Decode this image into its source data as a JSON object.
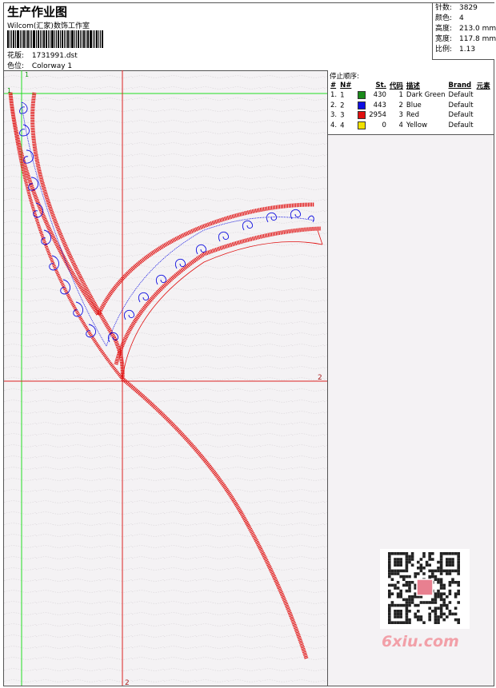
{
  "header": {
    "title": "生产作业图",
    "company": "Wilcom(汇家)数饰工作室",
    "design_label": "花版:",
    "design_value": "1731991.dst",
    "colorway_label": "色位:",
    "colorway_value": "Colorway 1"
  },
  "stats": {
    "stitches_label": "针数:",
    "stitches_value": "3829",
    "colors_label": "颜色:",
    "colors_value": "4",
    "height_label": "高度:",
    "height_value": "213.0 mm",
    "width_label": "宽度:",
    "width_value": "117.8 mm",
    "scale_label": "比例:",
    "scale_value": "1.13"
  },
  "stop_sequence": {
    "title": "停止顺序:",
    "columns": [
      "#",
      "N#",
      "St.",
      "代码",
      "描述",
      "Brand",
      "元素"
    ],
    "rows": [
      {
        "idx": "1.",
        "n": "1",
        "color": "#1a8a1a",
        "st": "430",
        "code": "1",
        "desc": "Dark Green",
        "brand": "Default"
      },
      {
        "idx": "2.",
        "n": "2",
        "color": "#1010e0",
        "st": "443",
        "code": "2",
        "desc": "Blue",
        "brand": "Default"
      },
      {
        "idx": "3.",
        "n": "3",
        "color": "#e01010",
        "st": "2954",
        "code": "3",
        "desc": "Red",
        "brand": "Default"
      },
      {
        "idx": "4.",
        "n": "4",
        "color": "#f0e000",
        "st": "0",
        "code": "4",
        "desc": "Yellow",
        "brand": "Default"
      }
    ]
  },
  "guides": {
    "green_top": "1",
    "green_left": "1",
    "red_right": "2",
    "red_bottom": "2"
  },
  "watermark": {
    "site": "6xiu.com"
  },
  "colors": {
    "stitch_red": "#e01010",
    "stitch_blue": "#1010e0",
    "guide_green": "#22dd22",
    "guide_red": "#dd2222"
  }
}
